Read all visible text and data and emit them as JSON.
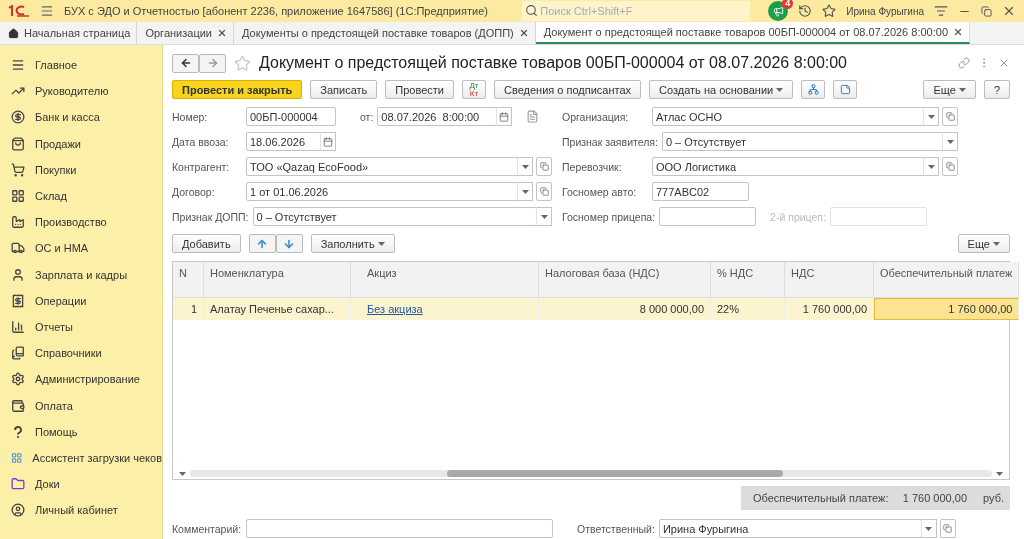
{
  "title_bar": {
    "title": "БУХ с ЭДО и Отчетностью [абонент 2236, приложение 1647586]  (1С:Предприятие)",
    "search": {
      "placeholder": "Поиск Ctrl+Shift+F"
    },
    "notifications": {
      "count": "4"
    },
    "user": "Ирина Фурыгина"
  },
  "tabs": [
    {
      "kind": "home",
      "label": "Начальная страница",
      "selected": false
    },
    {
      "kind": "page",
      "label": "Организации",
      "selected": false
    },
    {
      "kind": "page",
      "label": "Документы о предстоящей поставке товаров (ДОПП)",
      "selected": false
    },
    {
      "kind": "page",
      "label": "Документ о предстоящей поставке товаров 00БП-000004 от 08.07.2026 8:00:00",
      "selected": true
    }
  ],
  "sidebar": {
    "items": [
      {
        "label": "Главное"
      },
      {
        "label": "Руководителю"
      },
      {
        "label": "Банк и касса"
      },
      {
        "label": "Продажи"
      },
      {
        "label": "Покупки"
      },
      {
        "label": "Склад"
      },
      {
        "label": "Производство"
      },
      {
        "label": "ОС и НМА"
      },
      {
        "label": "Зарплата и кадры"
      },
      {
        "label": "Операции"
      },
      {
        "label": "Отчеты"
      },
      {
        "label": "Справочники"
      },
      {
        "label": "Администрирование"
      },
      {
        "label": "Оплата"
      },
      {
        "label": "Помощь"
      },
      {
        "label": "Ассистент загрузки чеков"
      },
      {
        "label": "Доки"
      },
      {
        "label": "Личный кабинет"
      }
    ]
  },
  "document": {
    "title": "Документ о предстоящей поставке товаров 00БП-000004 от 08.07.2026 8:00:00",
    "toolbar": [
      {
        "kind": "primary",
        "label": "Провести и закрыть"
      },
      {
        "kind": "plain",
        "label": "Записать"
      },
      {
        "kind": "plain",
        "label": "Провести"
      },
      {
        "kind": "dtkt",
        "top": "Дт",
        "bottom": "Кт"
      },
      {
        "kind": "plain",
        "label": "Сведения о подписантах"
      },
      {
        "kind": "menu",
        "label": "Создать на основании"
      },
      {
        "kind": "structure"
      },
      {
        "kind": "print"
      }
    ],
    "toolbar_right": [
      {
        "kind": "menu",
        "label": "Еще"
      },
      {
        "kind": "plain",
        "label": "?"
      }
    ],
    "left_fields": [
      [
        {
          "label": "Номер:",
          "value": "00БП-000004",
          "kind": "text"
        },
        {
          "label": "от:",
          "value": "08.07.2026  8:00:00",
          "kind": "date"
        },
        {
          "kind": "memo"
        }
      ],
      [
        {
          "label": "Дата ввоза:",
          "value": "18.06.2026",
          "kind": "date"
        }
      ],
      [
        {
          "label": "Контрагент:",
          "value": "ТОО «Qazaq EcoFood»",
          "kind": "reference"
        }
      ],
      [
        {
          "label": "Договор:",
          "value": "1 от 01.06.2026",
          "kind": "reference"
        }
      ],
      [
        {
          "label": "Признак ДОПП:",
          "value": "0 – Отсутствует",
          "kind": "choice"
        }
      ]
    ],
    "right_fields": [
      [
        {
          "label": "Организация:",
          "value": "Атлас ОСНО",
          "kind": "reference"
        }
      ],
      [
        {
          "label": "Признак заявителя:",
          "value": "0 – Отсутствует",
          "kind": "choice"
        }
      ],
      [
        {
          "label": "Перевозчик:",
          "value": "ООО Логистика",
          "kind": "reference"
        }
      ],
      [
        {
          "label": "Госномер авто:",
          "value": "777ABC02",
          "kind": "text"
        }
      ],
      [
        {
          "label": "Госномер прицепа:",
          "kind": "text"
        },
        {
          "label": "2-й прицеп:",
          "kind": "text",
          "disabled": true
        }
      ]
    ],
    "table_toolbar": [
      {
        "kind": "plain",
        "label": "Добавить"
      },
      {
        "kind": "updown"
      },
      {
        "kind": "menu",
        "label": "Заполнить"
      }
    ],
    "table_toolbar_right": [
      {
        "kind": "menu",
        "label": "Еще"
      }
    ],
    "table": {
      "columns": [
        "N",
        "Номенклатура",
        "",
        "Акциз",
        "Налоговая база (НДС)",
        "% НДС",
        "НДС",
        "Обеспечительный платеж"
      ],
      "rows": [
        {
          "selected": true,
          "cells": [
            {
              "kind": "number",
              "text": "1"
            },
            {
              "kind": "text",
              "text": "Алатау Печенье сахар..."
            },
            {
              "kind": "text"
            },
            {
              "kind": "link",
              "text": "Без акциза"
            },
            {
              "kind": "number",
              "text": "8 000 000,00"
            },
            {
              "kind": "text",
              "text": "22%"
            },
            {
              "kind": "number",
              "text": "1 760 000,00"
            },
            {
              "kind": "number",
              "text": "1 760 000,00",
              "current": true
            }
          ]
        }
      ]
    },
    "total": {
      "label": "Обеспечительный платеж:",
      "value": "1 760 000,00",
      "unit": "руб."
    },
    "bottom_fields": [
      {
        "label": "Комментарий:",
        "kind": "text"
      },
      {
        "label": "Ответственный:",
        "value": "Ирина Фурыгина",
        "kind": "reference"
      }
    ]
  }
}
